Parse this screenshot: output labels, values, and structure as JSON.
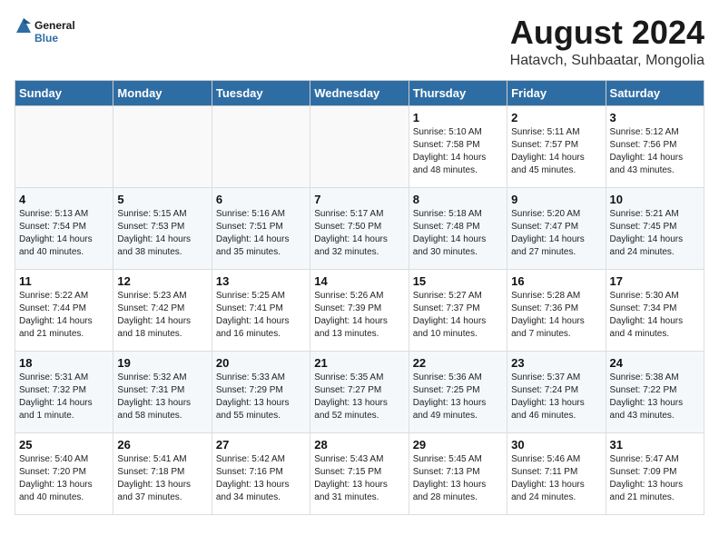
{
  "header": {
    "logo_general": "General",
    "logo_blue": "Blue",
    "month": "August 2024",
    "location": "Hatavch, Suhbaatar, Mongolia"
  },
  "days_of_week": [
    "Sunday",
    "Monday",
    "Tuesday",
    "Wednesday",
    "Thursday",
    "Friday",
    "Saturday"
  ],
  "weeks": [
    [
      {
        "day": "",
        "info": ""
      },
      {
        "day": "",
        "info": ""
      },
      {
        "day": "",
        "info": ""
      },
      {
        "day": "",
        "info": ""
      },
      {
        "day": "1",
        "info": "Sunrise: 5:10 AM\nSunset: 7:58 PM\nDaylight: 14 hours\nand 48 minutes."
      },
      {
        "day": "2",
        "info": "Sunrise: 5:11 AM\nSunset: 7:57 PM\nDaylight: 14 hours\nand 45 minutes."
      },
      {
        "day": "3",
        "info": "Sunrise: 5:12 AM\nSunset: 7:56 PM\nDaylight: 14 hours\nand 43 minutes."
      }
    ],
    [
      {
        "day": "4",
        "info": "Sunrise: 5:13 AM\nSunset: 7:54 PM\nDaylight: 14 hours\nand 40 minutes."
      },
      {
        "day": "5",
        "info": "Sunrise: 5:15 AM\nSunset: 7:53 PM\nDaylight: 14 hours\nand 38 minutes."
      },
      {
        "day": "6",
        "info": "Sunrise: 5:16 AM\nSunset: 7:51 PM\nDaylight: 14 hours\nand 35 minutes."
      },
      {
        "day": "7",
        "info": "Sunrise: 5:17 AM\nSunset: 7:50 PM\nDaylight: 14 hours\nand 32 minutes."
      },
      {
        "day": "8",
        "info": "Sunrise: 5:18 AM\nSunset: 7:48 PM\nDaylight: 14 hours\nand 30 minutes."
      },
      {
        "day": "9",
        "info": "Sunrise: 5:20 AM\nSunset: 7:47 PM\nDaylight: 14 hours\nand 27 minutes."
      },
      {
        "day": "10",
        "info": "Sunrise: 5:21 AM\nSunset: 7:45 PM\nDaylight: 14 hours\nand 24 minutes."
      }
    ],
    [
      {
        "day": "11",
        "info": "Sunrise: 5:22 AM\nSunset: 7:44 PM\nDaylight: 14 hours\nand 21 minutes."
      },
      {
        "day": "12",
        "info": "Sunrise: 5:23 AM\nSunset: 7:42 PM\nDaylight: 14 hours\nand 18 minutes."
      },
      {
        "day": "13",
        "info": "Sunrise: 5:25 AM\nSunset: 7:41 PM\nDaylight: 14 hours\nand 16 minutes."
      },
      {
        "day": "14",
        "info": "Sunrise: 5:26 AM\nSunset: 7:39 PM\nDaylight: 14 hours\nand 13 minutes."
      },
      {
        "day": "15",
        "info": "Sunrise: 5:27 AM\nSunset: 7:37 PM\nDaylight: 14 hours\nand 10 minutes."
      },
      {
        "day": "16",
        "info": "Sunrise: 5:28 AM\nSunset: 7:36 PM\nDaylight: 14 hours\nand 7 minutes."
      },
      {
        "day": "17",
        "info": "Sunrise: 5:30 AM\nSunset: 7:34 PM\nDaylight: 14 hours\nand 4 minutes."
      }
    ],
    [
      {
        "day": "18",
        "info": "Sunrise: 5:31 AM\nSunset: 7:32 PM\nDaylight: 14 hours\nand 1 minute."
      },
      {
        "day": "19",
        "info": "Sunrise: 5:32 AM\nSunset: 7:31 PM\nDaylight: 13 hours\nand 58 minutes."
      },
      {
        "day": "20",
        "info": "Sunrise: 5:33 AM\nSunset: 7:29 PM\nDaylight: 13 hours\nand 55 minutes."
      },
      {
        "day": "21",
        "info": "Sunrise: 5:35 AM\nSunset: 7:27 PM\nDaylight: 13 hours\nand 52 minutes."
      },
      {
        "day": "22",
        "info": "Sunrise: 5:36 AM\nSunset: 7:25 PM\nDaylight: 13 hours\nand 49 minutes."
      },
      {
        "day": "23",
        "info": "Sunrise: 5:37 AM\nSunset: 7:24 PM\nDaylight: 13 hours\nand 46 minutes."
      },
      {
        "day": "24",
        "info": "Sunrise: 5:38 AM\nSunset: 7:22 PM\nDaylight: 13 hours\nand 43 minutes."
      }
    ],
    [
      {
        "day": "25",
        "info": "Sunrise: 5:40 AM\nSunset: 7:20 PM\nDaylight: 13 hours\nand 40 minutes."
      },
      {
        "day": "26",
        "info": "Sunrise: 5:41 AM\nSunset: 7:18 PM\nDaylight: 13 hours\nand 37 minutes."
      },
      {
        "day": "27",
        "info": "Sunrise: 5:42 AM\nSunset: 7:16 PM\nDaylight: 13 hours\nand 34 minutes."
      },
      {
        "day": "28",
        "info": "Sunrise: 5:43 AM\nSunset: 7:15 PM\nDaylight: 13 hours\nand 31 minutes."
      },
      {
        "day": "29",
        "info": "Sunrise: 5:45 AM\nSunset: 7:13 PM\nDaylight: 13 hours\nand 28 minutes."
      },
      {
        "day": "30",
        "info": "Sunrise: 5:46 AM\nSunset: 7:11 PM\nDaylight: 13 hours\nand 24 minutes."
      },
      {
        "day": "31",
        "info": "Sunrise: 5:47 AM\nSunset: 7:09 PM\nDaylight: 13 hours\nand 21 minutes."
      }
    ]
  ]
}
